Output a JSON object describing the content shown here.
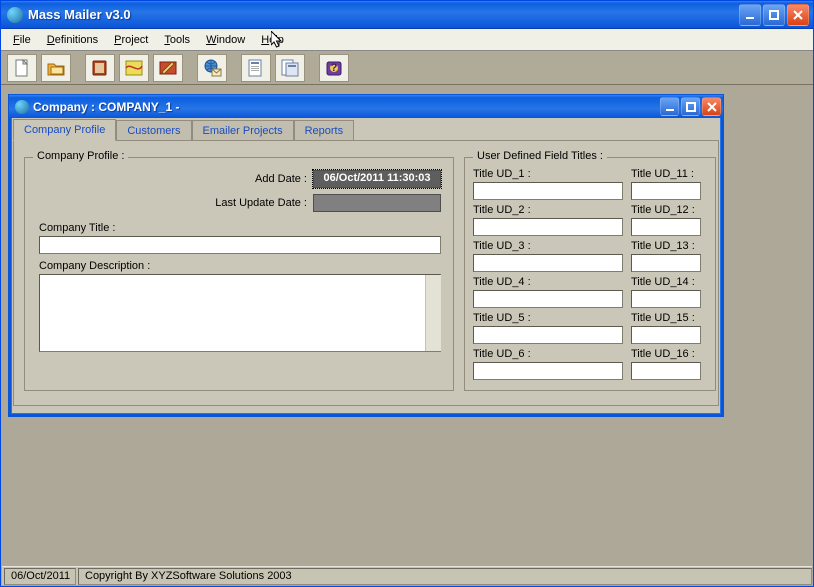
{
  "app": {
    "title": "Mass Mailer v3.0"
  },
  "menu": {
    "file": "File",
    "definitions": "Definitions",
    "project": "Project",
    "tools": "Tools",
    "window": "Window",
    "help": "Help"
  },
  "toolbar_icons": {
    "new": "new-document-icon",
    "folder": "folder-icon",
    "address": "address-book-icon",
    "map": "map-icon",
    "edit": "edit-note-icon",
    "globe": "globe-mail-icon",
    "report1": "report-icon",
    "report2": "report2-icon",
    "help": "help-book-icon"
  },
  "child": {
    "title": "Company : COMPANY_1  -"
  },
  "tabs": {
    "profile": "Company Profile",
    "customers": "Customers",
    "projects": "Emailer Projects",
    "reports": "Reports"
  },
  "groups": {
    "profile": "Company Profile :",
    "udtitles": "User Defined Field Titles :"
  },
  "profile": {
    "add_date_label": "Add Date :",
    "add_date_value": "06/Oct/2011 11:30:03",
    "last_update_label": "Last Update Date :",
    "last_update_value": "",
    "company_title_label": "Company Title :",
    "company_title_value": "",
    "company_desc_label": "Company Description :",
    "company_desc_value": ""
  },
  "ud": {
    "l1": "Title UD_1 :",
    "r1": "Title UD_11 :",
    "l2": "Title UD_2 :",
    "r2": "Title UD_12 :",
    "l3": "Title UD_3 :",
    "r3": "Title UD_13 :",
    "l4": "Title UD_4 :",
    "r4": "Title UD_14 :",
    "l5": "Title UD_5 :",
    "r5": "Title UD_15 :",
    "l6": "Title UD_6 :",
    "r6": "Title UD_16 :"
  },
  "status": {
    "date": "06/Oct/2011",
    "copyright": "Copyright By XYZSoftware Solutions 2003"
  }
}
